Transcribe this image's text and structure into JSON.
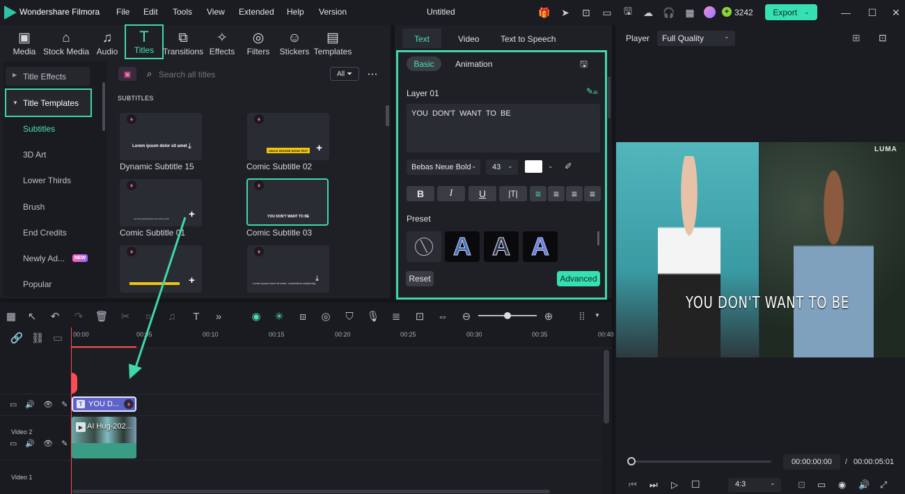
{
  "app": {
    "name": "Wondershare Filmora",
    "doc_title": "Untitled",
    "credits": "3242",
    "export_label": "Export"
  },
  "menu": [
    "File",
    "Edit",
    "Tools",
    "View",
    "Extended",
    "Help",
    "Version"
  ],
  "tools": [
    {
      "label": "Media",
      "icon": "media-icon"
    },
    {
      "label": "Stock Media",
      "icon": "stock-media-icon"
    },
    {
      "label": "Audio",
      "icon": "audio-icon"
    },
    {
      "label": "Titles",
      "icon": "titles-icon"
    },
    {
      "label": "Transitions",
      "icon": "transitions-icon"
    },
    {
      "label": "Effects",
      "icon": "effects-icon"
    },
    {
      "label": "Filters",
      "icon": "filters-icon"
    },
    {
      "label": "Stickers",
      "icon": "stickers-icon"
    },
    {
      "label": "Templates",
      "icon": "templates-icon"
    }
  ],
  "sidebar": {
    "items": [
      "Title Effects",
      "Title Templates",
      "Subtitles",
      "3D Art",
      "Lower Thirds",
      "Brush",
      "End Credits",
      "Newly Ad...",
      "Popular"
    ],
    "new_badge": "NEW"
  },
  "search": {
    "placeholder": "Search all titles",
    "filter_label": "All"
  },
  "library": {
    "section": "SUBTITLES",
    "cards": [
      {
        "label": "Dynamic Subtitle 15",
        "preview": "Lorem ipsum dolor sit amet"
      },
      {
        "label": "Comic Subtitle 02",
        "preview": "UNCLE SPAGHE SHOW TEXT"
      },
      {
        "label": "Comic Subtitle 01",
        "preview": "i am the world bottom text of the touch"
      },
      {
        "label": "Comic Subtitle 03",
        "preview": "YOU DON'T WANT TO BE"
      },
      {
        "label": "",
        "preview": ""
      },
      {
        "label": "",
        "preview": "Lorem ipsum dolor sit amet, consectetur adipiscing"
      }
    ]
  },
  "inspector": {
    "tabs": [
      "Text",
      "Video",
      "Text to Speech"
    ],
    "subtabs": [
      "Basic",
      "Animation"
    ],
    "layer": "Layer 01",
    "ai_label": "AI",
    "text_value": "YOU  DON'T  WANT  TO  BE",
    "font": "Bebas Neue Bold",
    "size": "43",
    "format_buttons": [
      "B",
      "I",
      "U"
    ],
    "preset_label": "Preset",
    "preset_letter": "A",
    "reset": "Reset",
    "advanced": "Advanced"
  },
  "player": {
    "label": "Player",
    "quality": "Full Quality",
    "overlay_text": "YOU DON'T WANT TO BE",
    "watermark": "LUMA",
    "current_time": "00:00:00:00",
    "separator": "/",
    "total_time": "00:00:05:01",
    "aspect": "4:3"
  },
  "timeline": {
    "ruler": [
      "00:00",
      "00:05",
      "00:10",
      "00:15",
      "00:20",
      "00:25",
      "00:30",
      "00:35",
      "00:40"
    ],
    "tracks": [
      {
        "name": ""
      },
      {
        "name": "Video 2"
      },
      {
        "name": "Video 1"
      }
    ],
    "title_clip": "YOU  D...",
    "video_clip": "AI Hug-202..."
  },
  "colors": {
    "accent": "#4be0b0",
    "highlight_box": "#3fd9a9",
    "playhead": "#ff4b55",
    "title_clip": "#6d6fd8",
    "video_clip": "#3a9c84"
  }
}
